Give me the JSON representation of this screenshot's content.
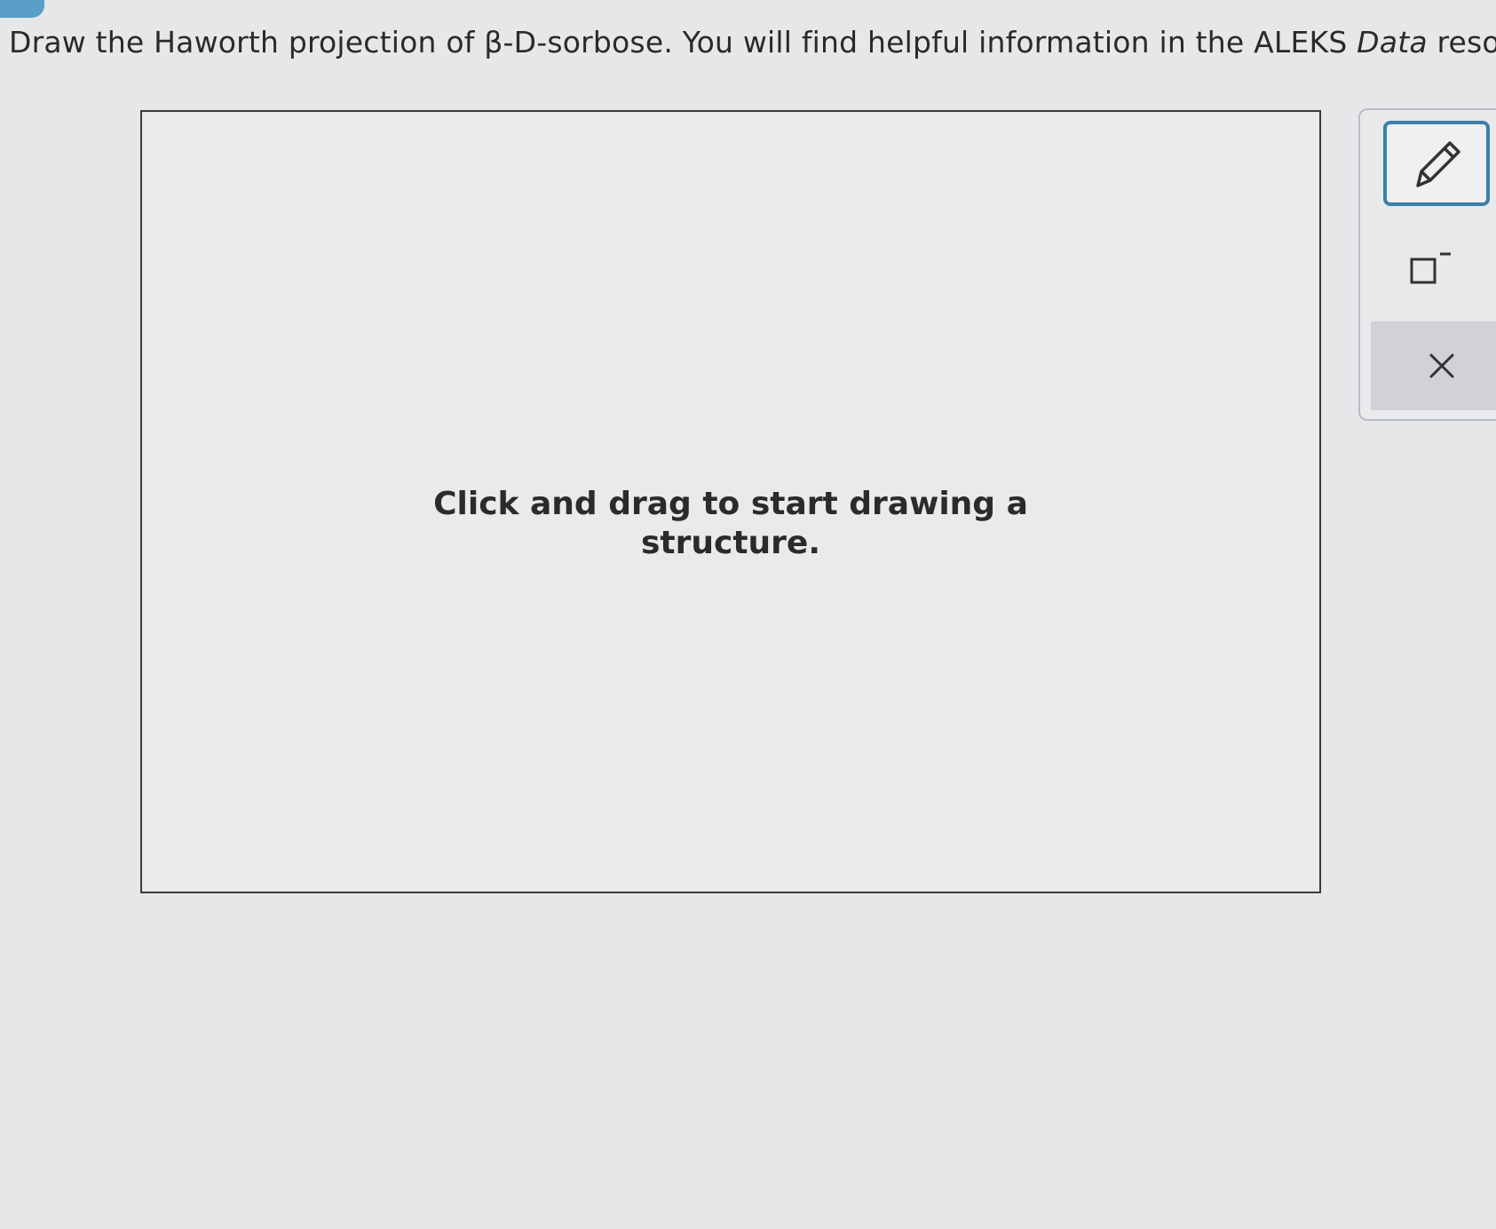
{
  "question": {
    "prefix": "Draw the Haworth projection of β-D-sorbose. You will find helpful information in the ALEKS ",
    "italic_word": "Data",
    "suffix": " resource"
  },
  "canvas": {
    "placeholder_line1": "Click and drag to start drawing a",
    "placeholder_line2": "structure."
  },
  "toolbar": {
    "tools": [
      {
        "name": "pencil",
        "icon": "pencil-icon",
        "selected": true
      },
      {
        "name": "charge",
        "icon": "charge-box-icon",
        "label": "−"
      },
      {
        "name": "clear",
        "icon": "close-icon"
      }
    ],
    "accent": "#3c7fa8"
  }
}
